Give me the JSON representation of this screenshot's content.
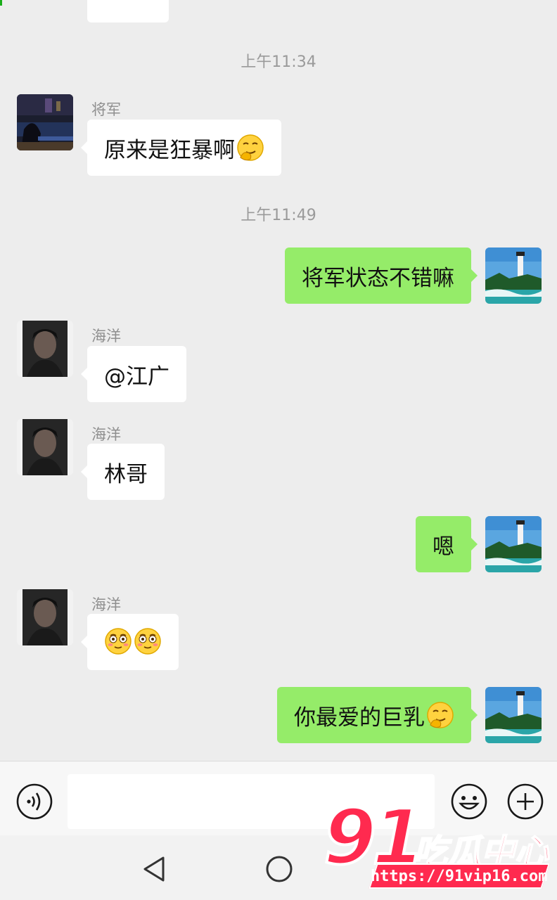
{
  "chat": {
    "time_1": "上午11:34",
    "time_2": "上午11:49",
    "msg_1": {
      "sender": "将军",
      "text": "原来是狂暴啊",
      "emoji": "smirk-hand-emoji"
    },
    "msg_2": {
      "text": "将军状态不错嘛"
    },
    "msg_3": {
      "sender": "海洋",
      "text": "@江广"
    },
    "msg_4": {
      "sender": "海洋",
      "text": "林哥"
    },
    "msg_5": {
      "text": "嗯"
    },
    "msg_6": {
      "sender": "海洋",
      "emojis": [
        "flushed-emoji",
        "flushed-emoji"
      ]
    },
    "msg_7": {
      "text": "你最爱的巨乳",
      "emoji": "smirk-hand-emoji"
    }
  },
  "input": {
    "value": "",
    "placeholder": ""
  },
  "icons": {
    "voice": "voice-icon",
    "emoji": "emoji-icon",
    "plus": "plus-icon",
    "back": "back-icon",
    "home": "home-icon"
  },
  "watermark": {
    "number": "91",
    "name": "吃瓜中心",
    "url": "https://91vip16.com"
  },
  "colors": {
    "outgoing_bubble": "#95ec69",
    "incoming_bubble": "#ffffff",
    "background": "#ededed",
    "watermark": "#ff2a4f"
  }
}
